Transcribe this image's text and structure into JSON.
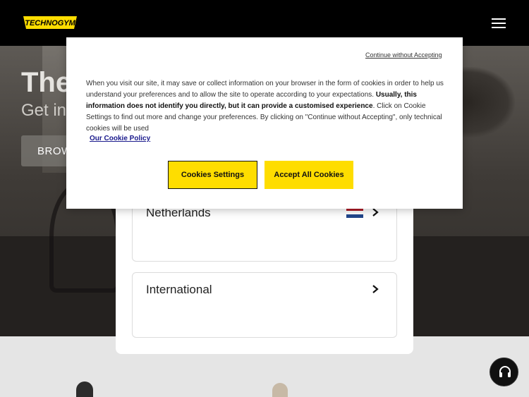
{
  "header": {
    "logo_text": "TECHNOGYM",
    "menu_icon": "hamburger-menu-icon"
  },
  "hero": {
    "title": "The",
    "subtitle": "Get in",
    "button_label": "BROW"
  },
  "cookie_banner": {
    "close_link": "Continue without Accepting",
    "text_part1": "When you visit our site, it may save or collect information on your browser in the form of cookies in order to help us understand your preferences and to allow the site to operate according to your expectations.",
    "text_bold": "Usually, this information does not identify you directly, but it can provide a customised experience",
    "text_part2": ". Click on Cookie Settings to find out more and change your preferences. By clicking on \"Continue without Accepting\", only technical cookies will be used",
    "policy_link": "Our Cookie Policy",
    "settings_button": "Cookies Settings",
    "accept_button": "Accept All Cookies",
    "accent_color": "#fedd00"
  },
  "country_selector": {
    "countries": [
      {
        "name": "Netherlands",
        "flag_icon": "netherlands-flag-icon"
      },
      {
        "name": "International",
        "flag_icon": ""
      }
    ]
  },
  "support": {
    "icon": "headset-icon"
  }
}
